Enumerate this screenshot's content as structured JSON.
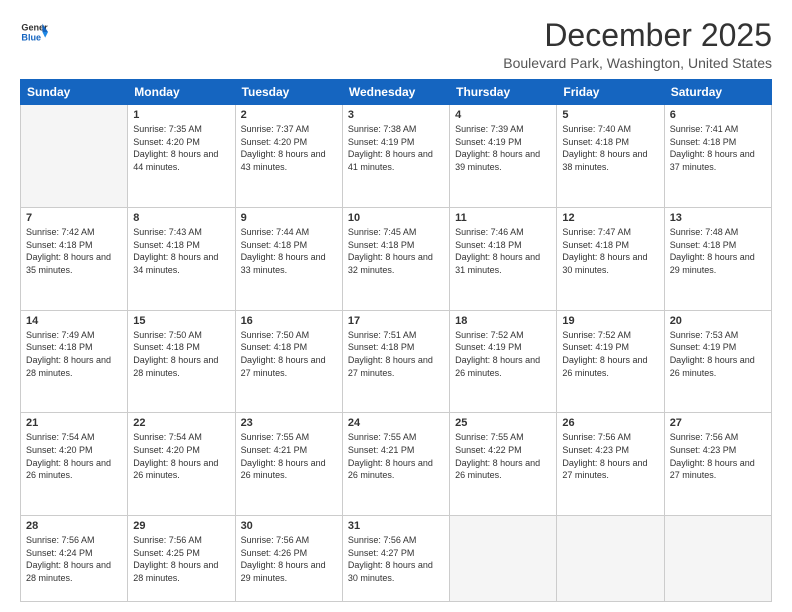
{
  "header": {
    "logo_line1": "General",
    "logo_line2": "Blue",
    "month": "December 2025",
    "location": "Boulevard Park, Washington, United States"
  },
  "days_of_week": [
    "Sunday",
    "Monday",
    "Tuesday",
    "Wednesday",
    "Thursday",
    "Friday",
    "Saturday"
  ],
  "weeks": [
    [
      {
        "day": "",
        "sunrise": "",
        "sunset": "",
        "daylight": ""
      },
      {
        "day": "1",
        "sunrise": "Sunrise: 7:35 AM",
        "sunset": "Sunset: 4:20 PM",
        "daylight": "Daylight: 8 hours and 44 minutes."
      },
      {
        "day": "2",
        "sunrise": "Sunrise: 7:37 AM",
        "sunset": "Sunset: 4:20 PM",
        "daylight": "Daylight: 8 hours and 43 minutes."
      },
      {
        "day": "3",
        "sunrise": "Sunrise: 7:38 AM",
        "sunset": "Sunset: 4:19 PM",
        "daylight": "Daylight: 8 hours and 41 minutes."
      },
      {
        "day": "4",
        "sunrise": "Sunrise: 7:39 AM",
        "sunset": "Sunset: 4:19 PM",
        "daylight": "Daylight: 8 hours and 39 minutes."
      },
      {
        "day": "5",
        "sunrise": "Sunrise: 7:40 AM",
        "sunset": "Sunset: 4:18 PM",
        "daylight": "Daylight: 8 hours and 38 minutes."
      },
      {
        "day": "6",
        "sunrise": "Sunrise: 7:41 AM",
        "sunset": "Sunset: 4:18 PM",
        "daylight": "Daylight: 8 hours and 37 minutes."
      }
    ],
    [
      {
        "day": "7",
        "sunrise": "Sunrise: 7:42 AM",
        "sunset": "Sunset: 4:18 PM",
        "daylight": "Daylight: 8 hours and 35 minutes."
      },
      {
        "day": "8",
        "sunrise": "Sunrise: 7:43 AM",
        "sunset": "Sunset: 4:18 PM",
        "daylight": "Daylight: 8 hours and 34 minutes."
      },
      {
        "day": "9",
        "sunrise": "Sunrise: 7:44 AM",
        "sunset": "Sunset: 4:18 PM",
        "daylight": "Daylight: 8 hours and 33 minutes."
      },
      {
        "day": "10",
        "sunrise": "Sunrise: 7:45 AM",
        "sunset": "Sunset: 4:18 PM",
        "daylight": "Daylight: 8 hours and 32 minutes."
      },
      {
        "day": "11",
        "sunrise": "Sunrise: 7:46 AM",
        "sunset": "Sunset: 4:18 PM",
        "daylight": "Daylight: 8 hours and 31 minutes."
      },
      {
        "day": "12",
        "sunrise": "Sunrise: 7:47 AM",
        "sunset": "Sunset: 4:18 PM",
        "daylight": "Daylight: 8 hours and 30 minutes."
      },
      {
        "day": "13",
        "sunrise": "Sunrise: 7:48 AM",
        "sunset": "Sunset: 4:18 PM",
        "daylight": "Daylight: 8 hours and 29 minutes."
      }
    ],
    [
      {
        "day": "14",
        "sunrise": "Sunrise: 7:49 AM",
        "sunset": "Sunset: 4:18 PM",
        "daylight": "Daylight: 8 hours and 28 minutes."
      },
      {
        "day": "15",
        "sunrise": "Sunrise: 7:50 AM",
        "sunset": "Sunset: 4:18 PM",
        "daylight": "Daylight: 8 hours and 28 minutes."
      },
      {
        "day": "16",
        "sunrise": "Sunrise: 7:50 AM",
        "sunset": "Sunset: 4:18 PM",
        "daylight": "Daylight: 8 hours and 27 minutes."
      },
      {
        "day": "17",
        "sunrise": "Sunrise: 7:51 AM",
        "sunset": "Sunset: 4:18 PM",
        "daylight": "Daylight: 8 hours and 27 minutes."
      },
      {
        "day": "18",
        "sunrise": "Sunrise: 7:52 AM",
        "sunset": "Sunset: 4:19 PM",
        "daylight": "Daylight: 8 hours and 26 minutes."
      },
      {
        "day": "19",
        "sunrise": "Sunrise: 7:52 AM",
        "sunset": "Sunset: 4:19 PM",
        "daylight": "Daylight: 8 hours and 26 minutes."
      },
      {
        "day": "20",
        "sunrise": "Sunrise: 7:53 AM",
        "sunset": "Sunset: 4:19 PM",
        "daylight": "Daylight: 8 hours and 26 minutes."
      }
    ],
    [
      {
        "day": "21",
        "sunrise": "Sunrise: 7:54 AM",
        "sunset": "Sunset: 4:20 PM",
        "daylight": "Daylight: 8 hours and 26 minutes."
      },
      {
        "day": "22",
        "sunrise": "Sunrise: 7:54 AM",
        "sunset": "Sunset: 4:20 PM",
        "daylight": "Daylight: 8 hours and 26 minutes."
      },
      {
        "day": "23",
        "sunrise": "Sunrise: 7:55 AM",
        "sunset": "Sunset: 4:21 PM",
        "daylight": "Daylight: 8 hours and 26 minutes."
      },
      {
        "day": "24",
        "sunrise": "Sunrise: 7:55 AM",
        "sunset": "Sunset: 4:21 PM",
        "daylight": "Daylight: 8 hours and 26 minutes."
      },
      {
        "day": "25",
        "sunrise": "Sunrise: 7:55 AM",
        "sunset": "Sunset: 4:22 PM",
        "daylight": "Daylight: 8 hours and 26 minutes."
      },
      {
        "day": "26",
        "sunrise": "Sunrise: 7:56 AM",
        "sunset": "Sunset: 4:23 PM",
        "daylight": "Daylight: 8 hours and 27 minutes."
      },
      {
        "day": "27",
        "sunrise": "Sunrise: 7:56 AM",
        "sunset": "Sunset: 4:23 PM",
        "daylight": "Daylight: 8 hours and 27 minutes."
      }
    ],
    [
      {
        "day": "28",
        "sunrise": "Sunrise: 7:56 AM",
        "sunset": "Sunset: 4:24 PM",
        "daylight": "Daylight: 8 hours and 28 minutes."
      },
      {
        "day": "29",
        "sunrise": "Sunrise: 7:56 AM",
        "sunset": "Sunset: 4:25 PM",
        "daylight": "Daylight: 8 hours and 28 minutes."
      },
      {
        "day": "30",
        "sunrise": "Sunrise: 7:56 AM",
        "sunset": "Sunset: 4:26 PM",
        "daylight": "Daylight: 8 hours and 29 minutes."
      },
      {
        "day": "31",
        "sunrise": "Sunrise: 7:56 AM",
        "sunset": "Sunset: 4:27 PM",
        "daylight": "Daylight: 8 hours and 30 minutes."
      },
      {
        "day": "",
        "sunrise": "",
        "sunset": "",
        "daylight": ""
      },
      {
        "day": "",
        "sunrise": "",
        "sunset": "",
        "daylight": ""
      },
      {
        "day": "",
        "sunrise": "",
        "sunset": "",
        "daylight": ""
      }
    ]
  ]
}
